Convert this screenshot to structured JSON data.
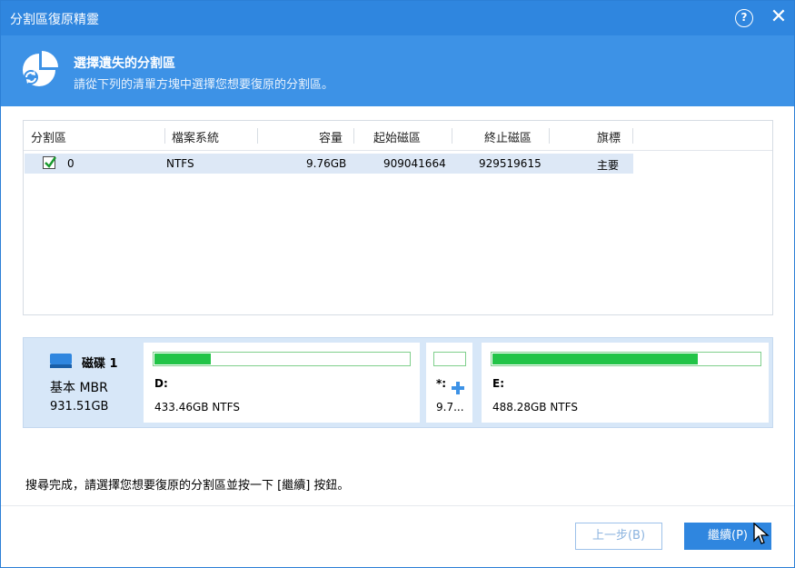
{
  "window": {
    "title": "分割區復原精靈",
    "help_glyph": "?",
    "close_glyph": "✕"
  },
  "banner": {
    "heading": "選擇遺失的分割區",
    "subtitle": "請從下列的清單方塊中選擇您想要復原的分割區。",
    "icon": "pie-recovery-icon"
  },
  "table": {
    "columns": [
      "分割區",
      "檔案系統",
      "容量",
      "起始磁區",
      "終止磁區",
      "旗標"
    ],
    "rows": [
      {
        "checked": true,
        "partition": "0",
        "filesystem": "NTFS",
        "capacity": "9.76GB",
        "start_sector": "909041664",
        "end_sector": "929519615",
        "flag": "主要"
      }
    ]
  },
  "disk": {
    "name": "磁碟 1",
    "type": "基本 MBR",
    "size": "931.51GB",
    "partitions": [
      {
        "label": "D:",
        "info": "433.46GB NTFS",
        "used_fraction": 0.22
      },
      {
        "label": "*:",
        "info": "9.7...",
        "used_fraction": 0.0
      },
      {
        "label": "E:",
        "info": "488.28GB NTFS",
        "used_fraction": 0.77
      }
    ]
  },
  "status_text": "搜尋完成，請選擇您想要復原的分割區並按一下 [繼續] 按鈕。",
  "buttons": {
    "back": "上一步(B)",
    "next": "繼續(P)"
  },
  "colors": {
    "accent": "#2f86df",
    "banner": "#3d92e6",
    "used_bar": "#22c447",
    "row_selected": "#dde8f6",
    "diskmap_bg": "#d7e7f8"
  }
}
